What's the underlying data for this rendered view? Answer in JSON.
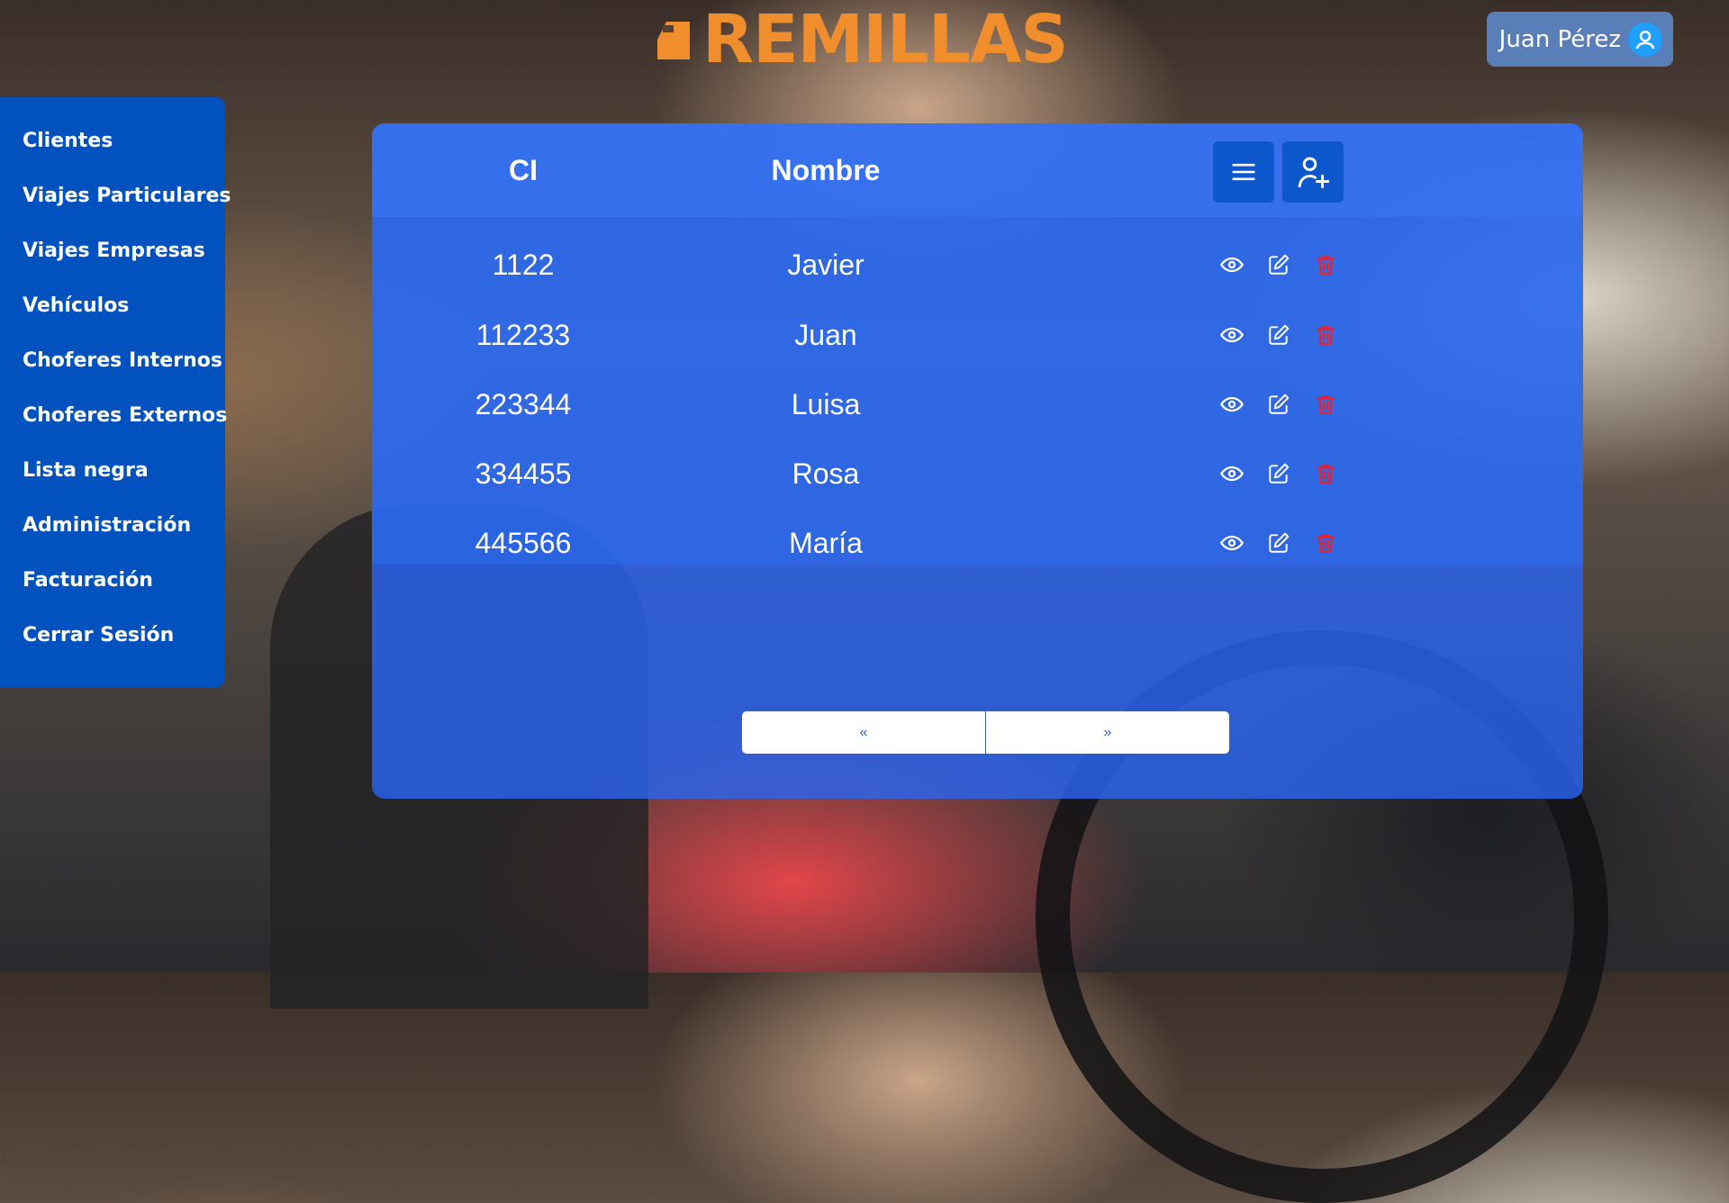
{
  "brand": {
    "name": "REMILLAS",
    "color": "#f08e2e"
  },
  "user": {
    "name": "Juan Pérez",
    "icon": "user-circle-icon"
  },
  "sidebar": {
    "items": [
      {
        "label": "Clientes"
      },
      {
        "label": "Viajes Particulares"
      },
      {
        "label": "Viajes Empresas"
      },
      {
        "label": "Vehículos"
      },
      {
        "label": "Choferes Internos"
      },
      {
        "label": "Choferes Externos"
      },
      {
        "label": "Lista negra"
      },
      {
        "label": "Administración"
      },
      {
        "label": "Facturación"
      },
      {
        "label": "Cerrar Sesión"
      }
    ]
  },
  "table": {
    "columns": {
      "ci": "CI",
      "nombre": "Nombre"
    },
    "header_actions": {
      "menu_icon": "hamburger-menu-icon",
      "add_icon": "add-user-icon"
    },
    "row_actions": {
      "view_icon": "eye-icon",
      "edit_icon": "edit-icon",
      "delete_icon": "trash-icon"
    },
    "rows": [
      {
        "ci": "1122",
        "nombre": "Javier"
      },
      {
        "ci": "112233",
        "nombre": "Juan"
      },
      {
        "ci": "223344",
        "nombre": "Luisa"
      },
      {
        "ci": "334455",
        "nombre": "Rosa"
      },
      {
        "ci": "445566",
        "nombre": "María"
      }
    ]
  },
  "pagination": {
    "prev_label": "«",
    "next_label": "»"
  },
  "colors": {
    "sidebar": "#0151bf",
    "panel": "#2a64f0",
    "delete": "#e8202f",
    "accent_button": "#0d57cc"
  }
}
